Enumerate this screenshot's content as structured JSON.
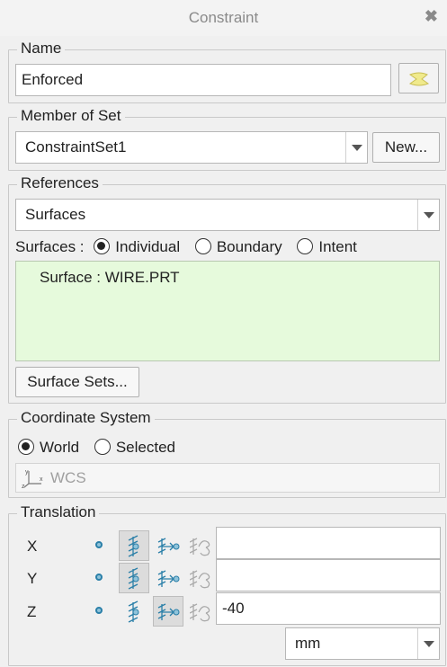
{
  "window": {
    "title": "Constraint",
    "close_glyph": "✖"
  },
  "name_group": {
    "legend": "Name",
    "value": "Enforced",
    "color_swatch": "#f3f0a8"
  },
  "member_group": {
    "legend": "Member of Set",
    "selected": "ConstraintSet1",
    "new_button": "New..."
  },
  "references_group": {
    "legend": "References",
    "type_selected": "Surfaces",
    "mode_label": "Surfaces :",
    "modes": [
      {
        "label": "Individual",
        "selected": true
      },
      {
        "label": "Boundary",
        "selected": false
      },
      {
        "label": "Intent",
        "selected": false
      }
    ],
    "items": [
      "Surface : WIRE.PRT"
    ],
    "surface_sets_button": "Surface Sets..."
  },
  "coord_group": {
    "legend": "Coordinate System",
    "options": [
      {
        "label": "World",
        "selected": true
      },
      {
        "label": "Selected",
        "selected": false
      }
    ],
    "csys_value": "WCS"
  },
  "translation_group": {
    "legend": "Translation",
    "rows": [
      {
        "axis": "X",
        "mode": "free",
        "value": ""
      },
      {
        "axis": "Y",
        "mode": "free",
        "value": ""
      },
      {
        "axis": "Z",
        "mode": "prescribed",
        "value": "-40"
      }
    ],
    "units": "mm"
  },
  "colors": {
    "list_bg": "#e6fadc",
    "accent": "#2a7fa8"
  }
}
